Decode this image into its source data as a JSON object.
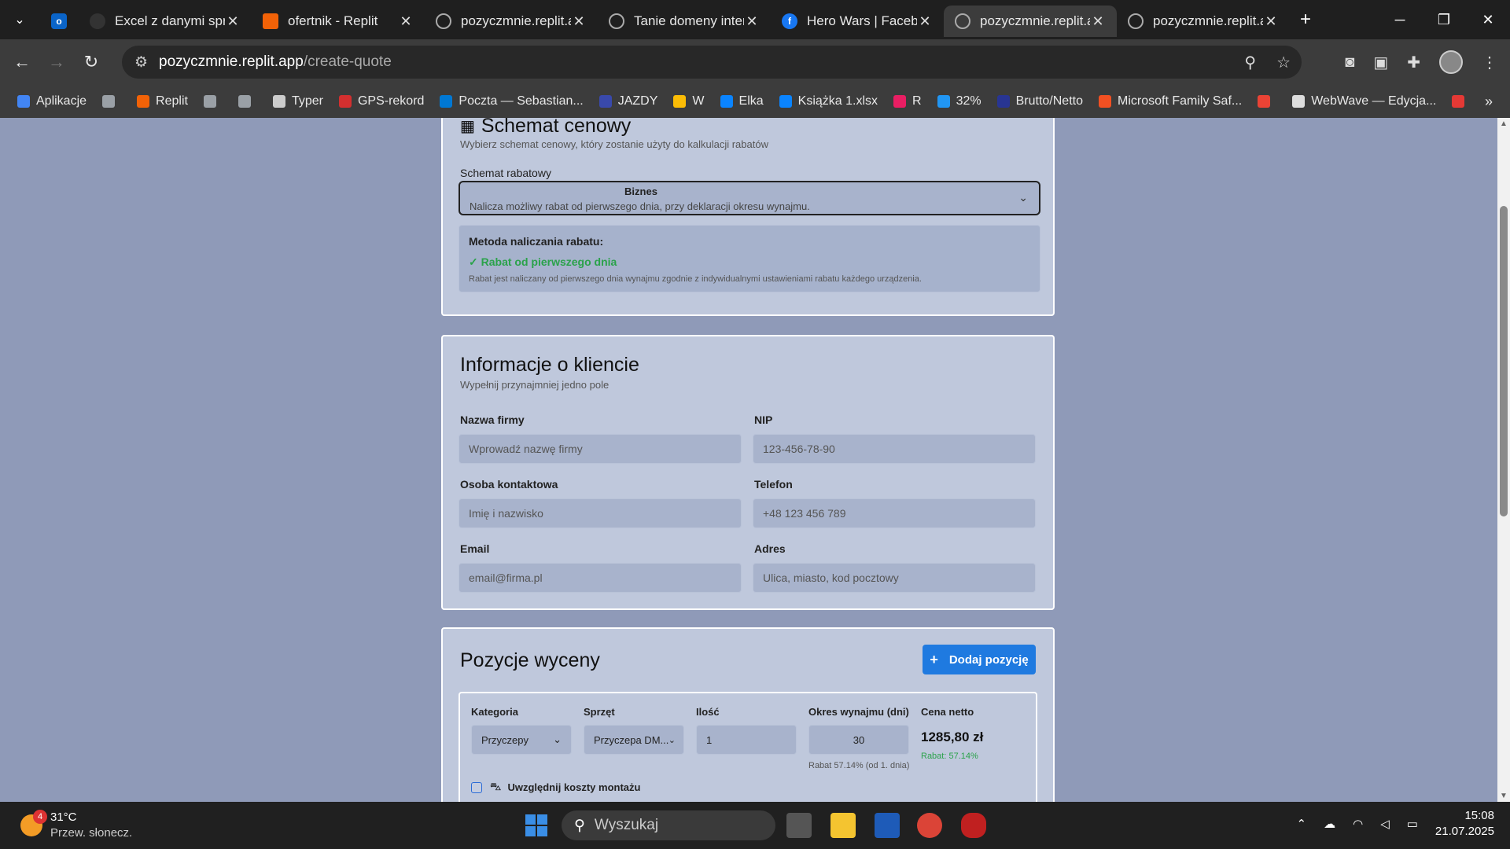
{
  "browser": {
    "tabs": [
      {
        "label": "",
        "icon": "outlook-icon"
      },
      {
        "label": "Excel z danymi sprz",
        "icon": "excel-icon"
      },
      {
        "label": "ofertnik - Replit",
        "icon": "replit-icon"
      },
      {
        "label": "pozyczmnie.replit.ap",
        "icon": "globe-icon"
      },
      {
        "label": "Tanie domeny intern",
        "icon": "globe-icon"
      },
      {
        "label": "Hero Wars | Facebo",
        "icon": "facebook-icon"
      },
      {
        "label": "pozyczmnie.replit.ap",
        "icon": "globe-icon",
        "active": true
      },
      {
        "label": "pozyczmnie.replit.ap",
        "icon": "globe-icon"
      }
    ],
    "url_host": "pozyczmnie.replit.app",
    "url_path": "/create-quote",
    "bookmarks": [
      {
        "label": "Aplikacje",
        "color": "#4285f4"
      },
      {
        "label": "",
        "color": "#9aa0a6"
      },
      {
        "label": "Replit",
        "color": "#f26207"
      },
      {
        "label": "",
        "color": "#9aa0a6"
      },
      {
        "label": "",
        "color": "#9aa0a6"
      },
      {
        "label": "Typer",
        "color": "#cccccc"
      },
      {
        "label": "GPS-rekord",
        "color": "#d32f2f"
      },
      {
        "label": "Poczta — Sebastian...",
        "color": "#0078d4"
      },
      {
        "label": "JAZDY",
        "color": "#3949ab"
      },
      {
        "label": "W",
        "color": "#fbbc05"
      },
      {
        "label": "Elka",
        "color": "#0a84ff"
      },
      {
        "label": "Książka 1.xlsx",
        "color": "#0a84ff"
      },
      {
        "label": "R",
        "color": "#e91e63"
      },
      {
        "label": "32%",
        "color": "#2196f3"
      },
      {
        "label": "Brutto/Netto",
        "color": "#283593"
      },
      {
        "label": "Microsoft Family Saf...",
        "color": "#f25022"
      },
      {
        "label": "",
        "color": "#ea4335"
      },
      {
        "label": "WebWave — Edycja...",
        "color": "#dddddd"
      },
      {
        "label": "",
        "color": "#e53935"
      }
    ]
  },
  "pricing": {
    "title": "Schemat cenowy",
    "subtitle": "Wybierz schemat cenowy, który zostanie użyty do kalkulacji rabatów",
    "select_label": "Schemat rabatowy",
    "select_value": "Biznes",
    "select_desc": "Nalicza możliwy rabat od pierwszego dnia, przy deklaracji okresu wynajmu.",
    "method_title": "Metoda naliczania rabatu:",
    "method_value": "✓ Rabat od pierwszego dnia",
    "method_desc": "Rabat jest naliczany od pierwszego dnia wynajmu zgodnie z indywidualnymi ustawieniami rabatu każdego urządzenia."
  },
  "client": {
    "title": "Informacje o kliencie",
    "subtitle": "Wypełnij przynajmniej jedno pole",
    "fields": {
      "company_label": "Nazwa firmy",
      "company_placeholder": "Wprowadź nazwę firmy",
      "nip_label": "NIP",
      "nip_placeholder": "123-456-78-90",
      "contact_label": "Osoba kontaktowa",
      "contact_placeholder": "Imię i nazwisko",
      "phone_label": "Telefon",
      "phone_placeholder": "+48 123 456 789",
      "email_label": "Email",
      "email_placeholder": "email@firma.pl",
      "address_label": "Adres",
      "address_placeholder": "Ulica, miasto, kod pocztowy"
    }
  },
  "items": {
    "title": "Pozycje wyceny",
    "add_button": "Dodaj pozycję",
    "columns": [
      "Kategoria",
      "Sprzęt",
      "Ilość",
      "Okres wynajmu (dni)",
      "Cena netto"
    ],
    "row": {
      "category": "Przyczepy",
      "equipment": "Przyczepa DM...",
      "quantity": "1",
      "period": "30",
      "period_note": "Rabat 57.14% (od 1. dnia)",
      "price": "1285,80 zł",
      "discount": "Rabat: 57.14%"
    },
    "assembly_label": "Uwzględnij koszty montażu"
  },
  "taskbar": {
    "temp": "31°C",
    "weather": "Przew. słonecz.",
    "weather_badge": "4",
    "search": "Wyszukaj",
    "time": "15:08",
    "date": "21.07.2025"
  }
}
